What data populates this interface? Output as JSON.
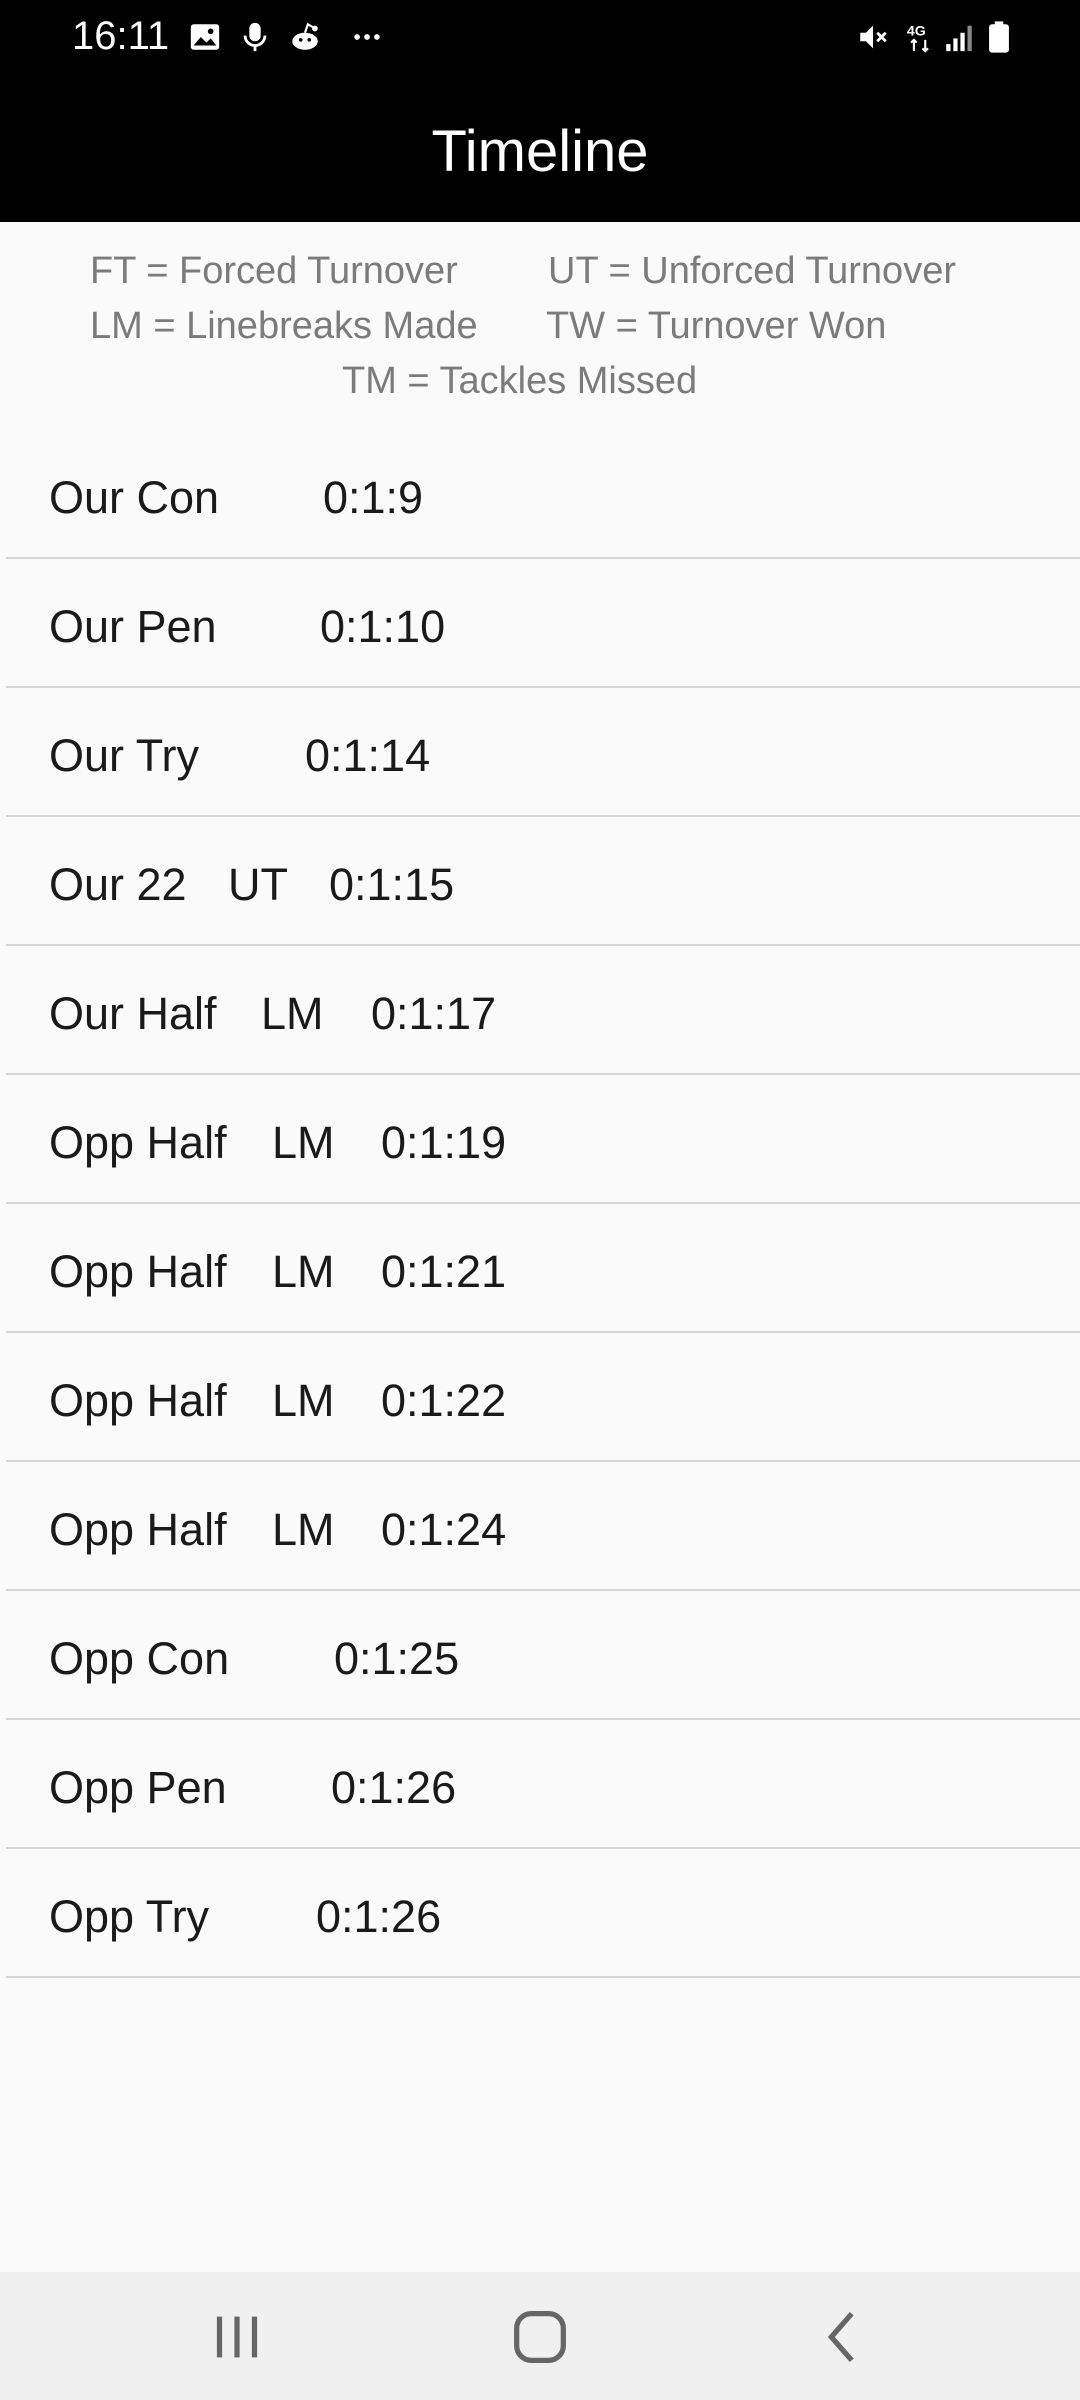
{
  "status_bar": {
    "time": "16:11",
    "icons": [
      "gallery-icon",
      "microphone-icon",
      "reddit-icon",
      "more-dots-icon",
      "mute-icon",
      "network-4g-icon",
      "signal-icon",
      "battery-icon"
    ],
    "network_label": "4G"
  },
  "app_bar": {
    "title": "Timeline"
  },
  "legend": {
    "line1_left": "FT = Forced Turnover",
    "line1_right": "UT = Unforced Turnover",
    "line2_left": "LM = Linebreaks Made",
    "line2_right": "TW = Turnover Won",
    "line3": "TM = Tackles Missed"
  },
  "rows": [
    {
      "zone": "Our Con",
      "code": "",
      "time": "0:1:9"
    },
    {
      "zone": "Our Pen",
      "code": "",
      "time": "0:1:10"
    },
    {
      "zone": "Our Try",
      "code": "",
      "time": "0:1:14"
    },
    {
      "zone": "Our 22",
      "code": "UT",
      "time": "0:1:15"
    },
    {
      "zone": "Our Half",
      "code": "LM",
      "time": "0:1:17"
    },
    {
      "zone": "Opp Half",
      "code": "LM",
      "time": "0:1:19"
    },
    {
      "zone": "Opp Half",
      "code": "LM",
      "time": "0:1:21"
    },
    {
      "zone": "Opp Half",
      "code": "LM",
      "time": "0:1:22"
    },
    {
      "zone": "Opp Half",
      "code": "LM",
      "time": "0:1:24"
    },
    {
      "zone": "Opp Con",
      "code": "",
      "time": "0:1:25"
    },
    {
      "zone": "Opp Pen",
      "code": "",
      "time": "0:1:26"
    },
    {
      "zone": "Opp Try",
      "code": "",
      "time": "0:1:26"
    }
  ],
  "nav_bar": {
    "buttons": [
      "recent-apps-icon",
      "home-icon",
      "back-icon"
    ]
  },
  "colors": {
    "app_bar": "#000000",
    "background": "#fafafa",
    "legend_text": "#7b7b7b",
    "divider": "#d6d6d6"
  }
}
